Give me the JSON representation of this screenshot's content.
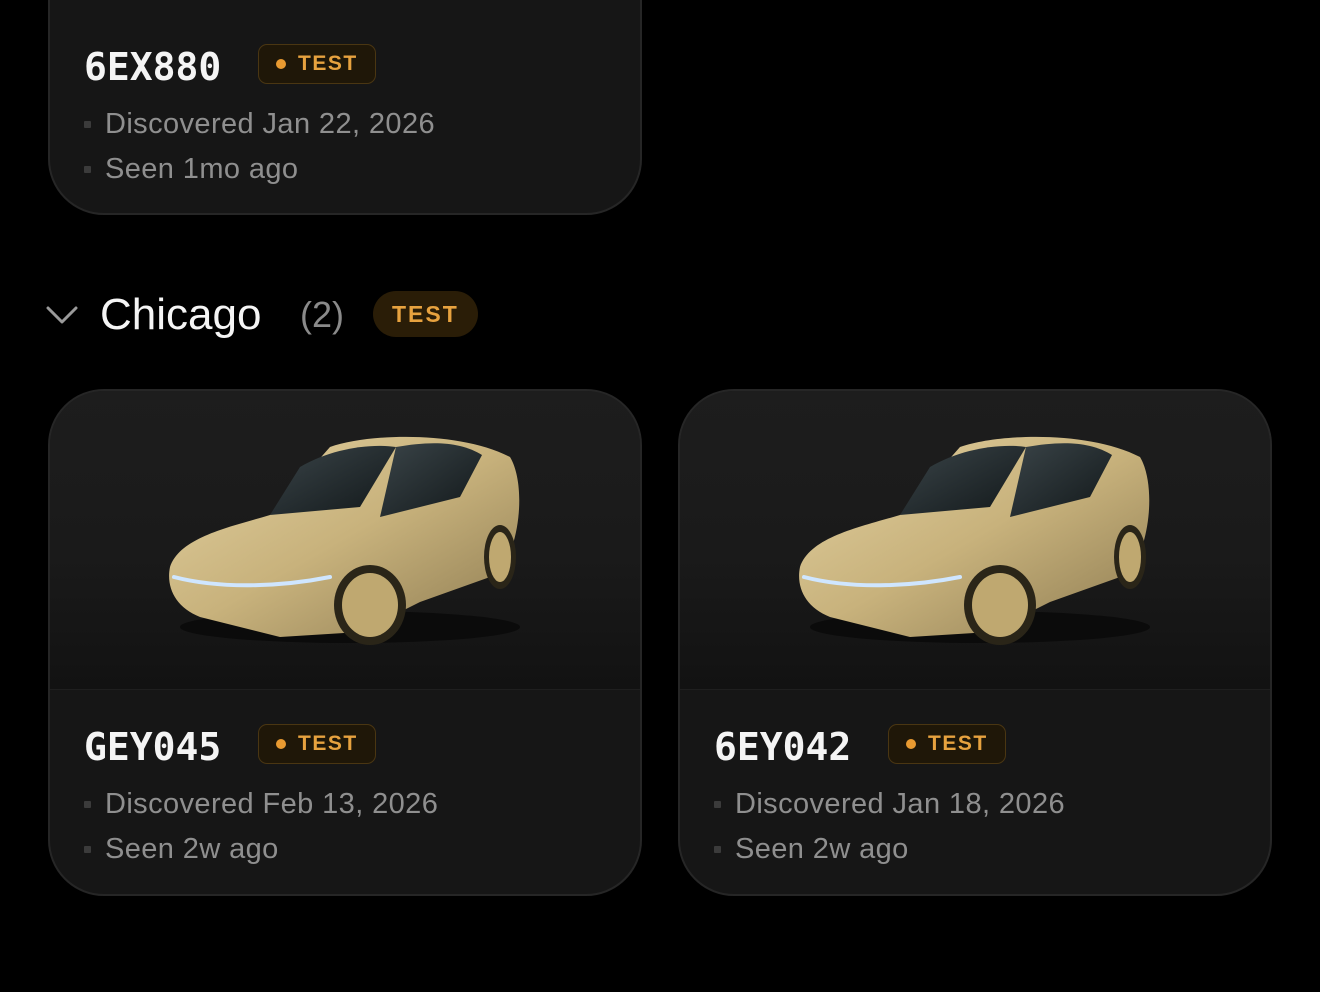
{
  "colors": {
    "background": "#000000",
    "card": "#161616",
    "accent": "#e7a23f"
  },
  "top_card": {
    "plate": "6EX880",
    "badge": "TEST",
    "discovered": "Discovered Jan 22, 2026",
    "seen": "Seen 1mo ago"
  },
  "group": {
    "icon": "chevron-down-icon",
    "title": "Chicago",
    "count": "(2)",
    "badge": "TEST"
  },
  "vehicles": [
    {
      "plate": "GEY045",
      "badge": "TEST",
      "discovered": "Discovered Feb 13, 2026",
      "seen": "Seen 2w ago",
      "image": "gold-two-door-car"
    },
    {
      "plate": "6EY042",
      "badge": "TEST",
      "discovered": "Discovered Jan 18, 2026",
      "seen": "Seen 2w ago",
      "image": "gold-two-door-car"
    }
  ]
}
